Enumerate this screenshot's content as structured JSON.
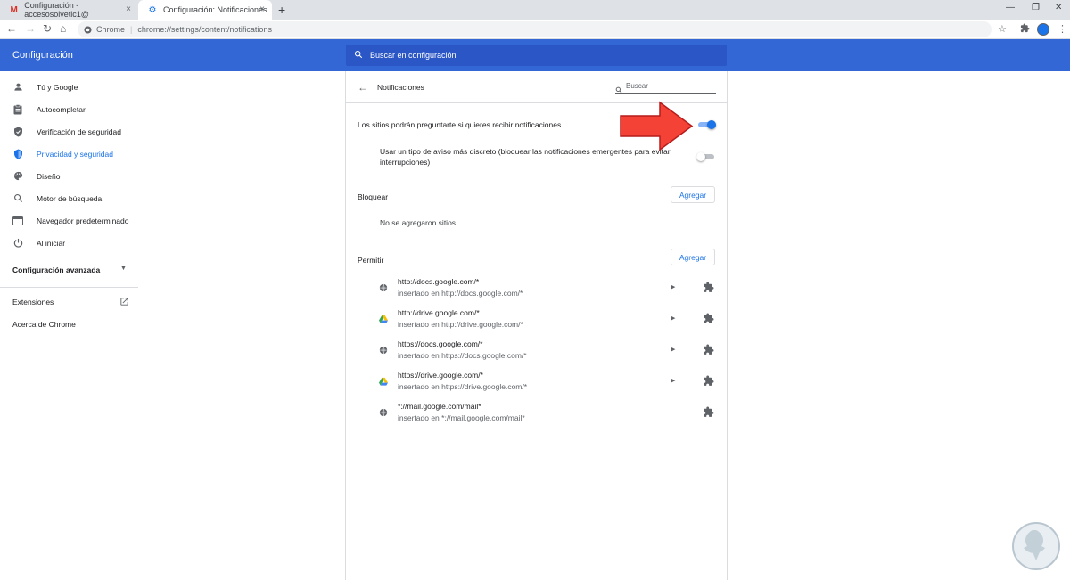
{
  "tabs": [
    {
      "label": "Configuración - accesosolvetic1@",
      "icon": "gmail-icon",
      "close": "×"
    },
    {
      "label": "Configuración: Notificaciones",
      "icon": "gear-icon",
      "close": "×"
    }
  ],
  "new_tab": "+",
  "window_controls": {
    "minimize": "—",
    "maximize": "❐",
    "close": "✕"
  },
  "toolbar": {
    "back": "←",
    "forward": "→",
    "reload": "↻",
    "home": "⌂"
  },
  "omnibox": {
    "site_label": "Chrome",
    "separator": "|",
    "url": "chrome://settings/content/notifications"
  },
  "header": {
    "title": "Configuración",
    "search_placeholder": "Buscar en configuración"
  },
  "sidebar": {
    "items": [
      {
        "label": "Tú y Google",
        "icon": "person-icon"
      },
      {
        "label": "Autocompletar",
        "icon": "clipboard-icon"
      },
      {
        "label": "Verificación de seguridad",
        "icon": "shield-check-icon"
      },
      {
        "label": "Privacidad y seguridad",
        "icon": "shield-icon",
        "active": true
      },
      {
        "label": "Diseño",
        "icon": "palette-icon"
      },
      {
        "label": "Motor de búsqueda",
        "icon": "search-icon"
      },
      {
        "label": "Navegador predeterminado",
        "icon": "browser-icon"
      },
      {
        "label": "Al iniciar",
        "icon": "power-icon"
      }
    ],
    "advanced": "Configuración avanzada",
    "extensions": "Extensiones",
    "about": "Acerca de Chrome"
  },
  "page": {
    "title": "Notificaciones",
    "search_placeholder": "Buscar",
    "ask_label": "Los sitios podrán preguntarte si quieres recibir notificaciones",
    "ask_enabled": true,
    "quiet_label_line1": "Usar un tipo de aviso más discreto (bloquear las notificaciones emergentes para evitar",
    "quiet_label_line2": "interrupciones)",
    "quiet_enabled": false,
    "block_title": "Bloquear",
    "block_add": "Agregar",
    "block_empty": "No se agregaron sitios",
    "allow_title": "Permitir",
    "allow_add": "Agregar",
    "allow_sites": [
      {
        "host": "http://docs.google.com/*",
        "embedded": "insertado en http://docs.google.com/*",
        "icon": "globe-icon",
        "expandable": true
      },
      {
        "host": "http://drive.google.com/*",
        "embedded": "insertado en http://drive.google.com/*",
        "icon": "drive-icon",
        "expandable": true
      },
      {
        "host": "https://docs.google.com/*",
        "embedded": "insertado en https://docs.google.com/*",
        "icon": "globe-icon",
        "expandable": true
      },
      {
        "host": "https://drive.google.com/*",
        "embedded": "insertado en https://drive.google.com/*",
        "icon": "drive-icon",
        "expandable": true
      },
      {
        "host": "*://mail.google.com/mail*",
        "embedded": "insertado en *://mail.google.com/mail*",
        "icon": "globe-icon",
        "expandable": false
      }
    ]
  },
  "colors": {
    "header": "#3367d6",
    "accent": "#1a73e8",
    "annotation_arrow": "#f44336"
  }
}
